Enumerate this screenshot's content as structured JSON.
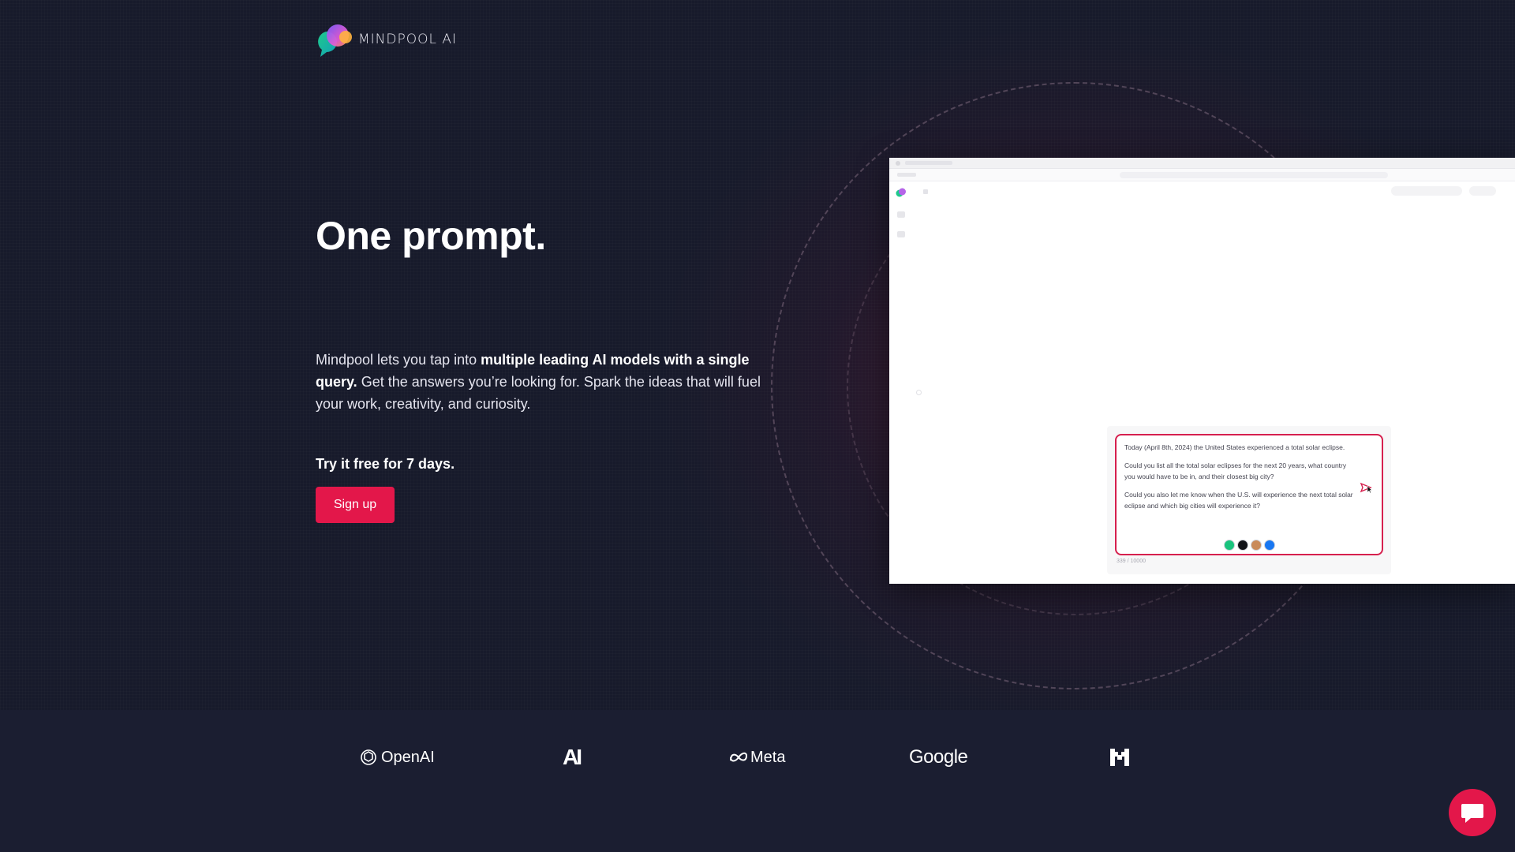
{
  "brand": {
    "name": "MINDPOOL AI",
    "logo_icon": "mindpool-bubble-logo"
  },
  "hero": {
    "title": "One prompt.",
    "desc_part1": "Mindpool lets you tap into ",
    "desc_bold": "multiple leading AI models with a single query.",
    "desc_part2": " Get the answers you’re looking for. Spark the ideas that will fuel your work, creativity, and curiosity.",
    "trial": "Try it free for 7 days.",
    "signup_label": "Sign up"
  },
  "preview": {
    "prompt_p1": "Today (April 8th, 2024) the United States experienced a total solar eclipse.",
    "prompt_p2": "Could you list all the total solar eclipses for the next 20 years, what country you would have to be in, and their closest big city?",
    "prompt_p3": "Could you also let me know when the U.S. will experience the next total solar eclipse and which big cities will experience it?",
    "counter": "339 / 10000",
    "model_icons": [
      "openai-icon",
      "mistral-icon",
      "anthropic-icon",
      "meta-icon"
    ]
  },
  "partners": [
    {
      "name": "OpenAI",
      "icon": "openai-icon"
    },
    {
      "name": "AI",
      "icon": "anthropic-icon"
    },
    {
      "name": "Meta",
      "icon": "meta-icon"
    },
    {
      "name": "Google",
      "icon": "google-wordmark"
    },
    {
      "name": "M",
      "icon": "mistral-icon"
    }
  ],
  "colors": {
    "accent": "#e3174a",
    "background": "#171a2b",
    "strip": "#1b1e31"
  },
  "chat": {
    "icon": "chat-bubble-icon"
  }
}
